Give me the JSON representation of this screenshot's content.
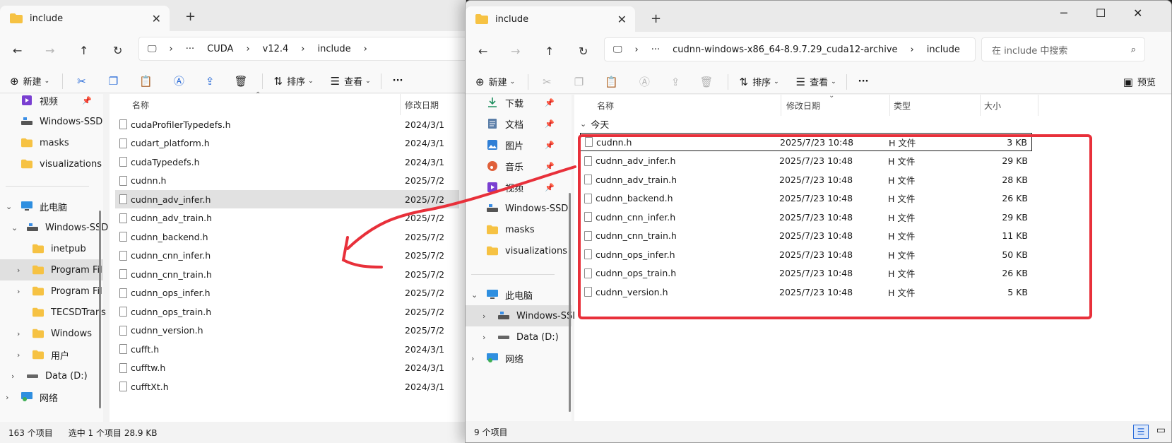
{
  "left_window": {
    "tab_title": "include",
    "breadcrumb": [
      "CUDA",
      "v12.4",
      "include"
    ],
    "commands": {
      "new": "新建",
      "sort": "排序",
      "view": "查看"
    },
    "nav_items": [
      {
        "label": "视频",
        "pinned": true
      },
      {
        "label": "Windows-SSD"
      },
      {
        "label": "masks"
      },
      {
        "label": "visualizations"
      },
      {
        "label": "此电脑"
      },
      {
        "label": "Windows-SSD"
      },
      {
        "label": "inetpub"
      },
      {
        "label": "Program Fil"
      },
      {
        "label": "Program Fil"
      },
      {
        "label": "TECSDTrans"
      },
      {
        "label": "Windows"
      },
      {
        "label": "用户"
      },
      {
        "label": "Data (D:)"
      },
      {
        "label": "网络"
      }
    ],
    "columns": {
      "name": "名称",
      "date": "修改日期"
    },
    "files": [
      {
        "name": "cudaProfilerTypedefs.h",
        "date": "2024/3/1"
      },
      {
        "name": "cudart_platform.h",
        "date": "2024/3/1"
      },
      {
        "name": "cudaTypedefs.h",
        "date": "2024/3/1"
      },
      {
        "name": "cudnn.h",
        "date": "2025/7/2"
      },
      {
        "name": "cudnn_adv_infer.h",
        "date": "2025/7/2",
        "selected": true
      },
      {
        "name": "cudnn_adv_train.h",
        "date": "2025/7/2"
      },
      {
        "name": "cudnn_backend.h",
        "date": "2025/7/2"
      },
      {
        "name": "cudnn_cnn_infer.h",
        "date": "2025/7/2"
      },
      {
        "name": "cudnn_cnn_train.h",
        "date": "2025/7/2"
      },
      {
        "name": "cudnn_ops_infer.h",
        "date": "2025/7/2"
      },
      {
        "name": "cudnn_ops_train.h",
        "date": "2025/7/2"
      },
      {
        "name": "cudnn_version.h",
        "date": "2025/7/2"
      },
      {
        "name": "cufft.h",
        "date": "2024/3/1"
      },
      {
        "name": "cufftw.h",
        "date": "2024/3/1"
      },
      {
        "name": "cufftXt.h",
        "date": "2024/3/1"
      }
    ],
    "status": {
      "count": "163 个项目",
      "selection": "选中 1 个项目 28.9 KB"
    }
  },
  "right_window": {
    "tab_title": "include",
    "breadcrumb": [
      "cudnn-windows-x86_64-8.9.7.29_cuda12-archive",
      "include"
    ],
    "search_placeholder": "在 include 中搜索",
    "commands": {
      "new": "新建",
      "sort": "排序",
      "view": "查看",
      "preview": "预览"
    },
    "nav_items": [
      {
        "label": "下载",
        "pinned": true
      },
      {
        "label": "文档",
        "pinned": true
      },
      {
        "label": "图片",
        "pinned": true
      },
      {
        "label": "音乐",
        "pinned": true
      },
      {
        "label": "视频",
        "pinned": true
      },
      {
        "label": "Windows-SSD"
      },
      {
        "label": "masks"
      },
      {
        "label": "visualizations"
      },
      {
        "label": "此电脑"
      },
      {
        "label": "Windows-SSD"
      },
      {
        "label": "Data (D:)"
      },
      {
        "label": "网络"
      }
    ],
    "columns": {
      "name": "名称",
      "date": "修改日期",
      "type": "类型",
      "size": "大小"
    },
    "group_label": "今天",
    "files": [
      {
        "name": "cudnn.h",
        "date": "2025/7/23 10:48",
        "type": "H 文件",
        "size": "3 KB",
        "focused": true
      },
      {
        "name": "cudnn_adv_infer.h",
        "date": "2025/7/23 10:48",
        "type": "H 文件",
        "size": "29 KB"
      },
      {
        "name": "cudnn_adv_train.h",
        "date": "2025/7/23 10:48",
        "type": "H 文件",
        "size": "28 KB"
      },
      {
        "name": "cudnn_backend.h",
        "date": "2025/7/23 10:48",
        "type": "H 文件",
        "size": "26 KB"
      },
      {
        "name": "cudnn_cnn_infer.h",
        "date": "2025/7/23 10:48",
        "type": "H 文件",
        "size": "29 KB"
      },
      {
        "name": "cudnn_cnn_train.h",
        "date": "2025/7/23 10:48",
        "type": "H 文件",
        "size": "11 KB"
      },
      {
        "name": "cudnn_ops_infer.h",
        "date": "2025/7/23 10:48",
        "type": "H 文件",
        "size": "50 KB"
      },
      {
        "name": "cudnn_ops_train.h",
        "date": "2025/7/23 10:48",
        "type": "H 文件",
        "size": "26 KB"
      },
      {
        "name": "cudnn_version.h",
        "date": "2025/7/23 10:48",
        "type": "H 文件",
        "size": "5 KB"
      }
    ],
    "status": {
      "count": "9 个项目"
    }
  },
  "colors": {
    "annotation_red": "#e8303a",
    "folder_yellow": "#f6c243",
    "selection": "#e1e1e1"
  }
}
